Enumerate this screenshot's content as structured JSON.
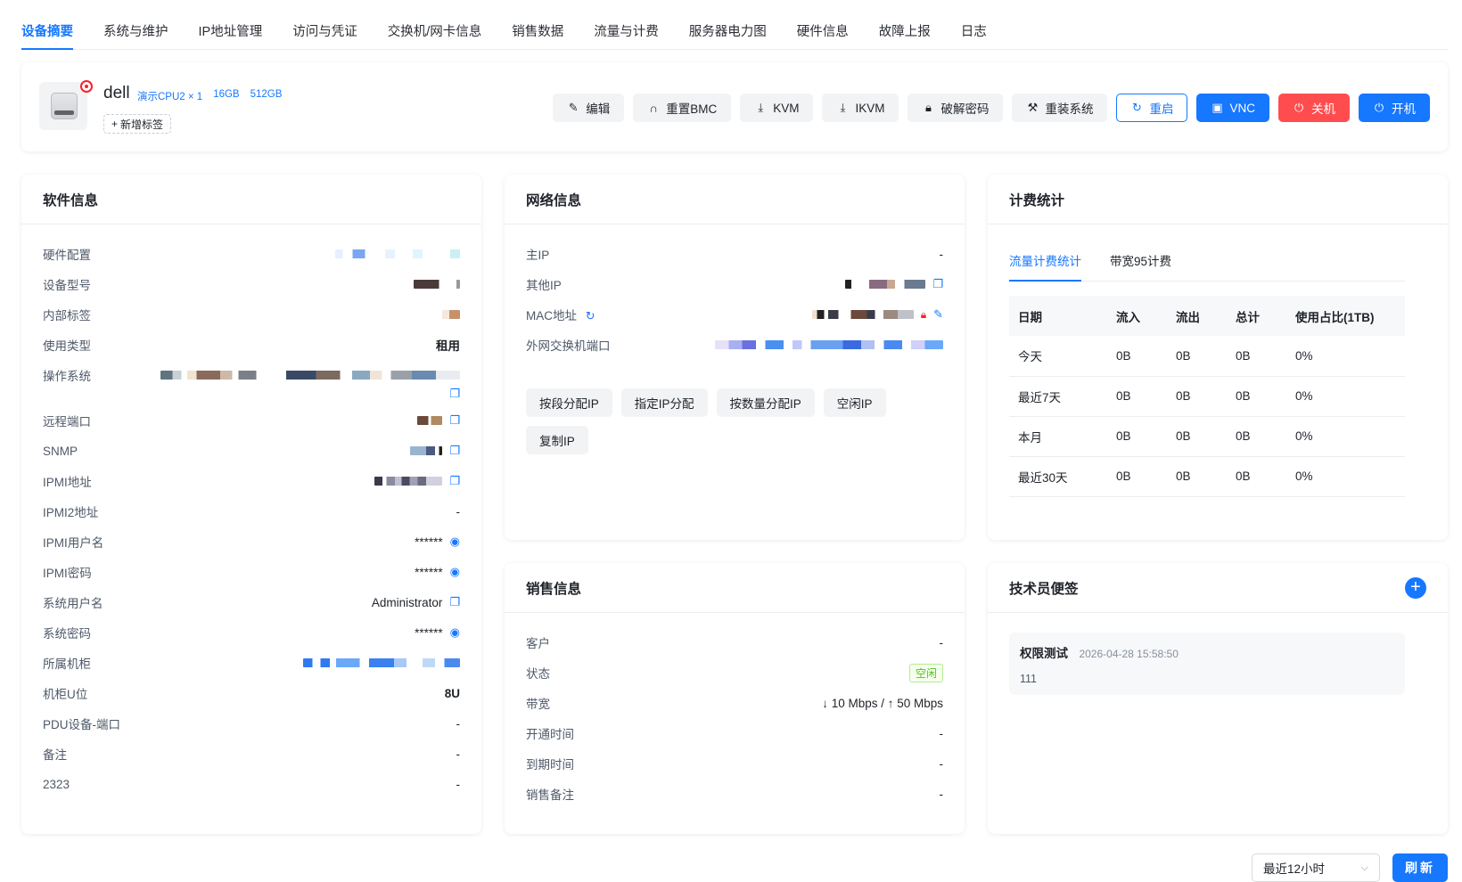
{
  "tabs": [
    "设备摘要",
    "系统与维护",
    "IP地址管理",
    "访问与凭证",
    "交换机/网卡信息",
    "销售数据",
    "流量与计费",
    "服务器电力图",
    "硬件信息",
    "故障上报",
    "日志"
  ],
  "device": {
    "name": "dell",
    "spec_cpu": "演示CPU2 × 1",
    "spec_mem": "16GB",
    "spec_disk": "512GB",
    "add_tag": "新增标签"
  },
  "actions": {
    "edit": "编辑",
    "reset_bmc": "重置BMC",
    "kvm": "KVM",
    "ikvm": "IKVM",
    "crack_pwd": "破解密码",
    "reinstall": "重装系统",
    "reboot": "重启",
    "vnc": "VNC",
    "shutdown": "关机",
    "power_on": "开机"
  },
  "software": {
    "title": "软件信息",
    "rows": [
      {
        "k": "硬件配置",
        "v": ""
      },
      {
        "k": "设备型号",
        "v": ""
      },
      {
        "k": "内部标签",
        "v": ""
      },
      {
        "k": "使用类型",
        "v": "租用"
      },
      {
        "k": "操作系统",
        "v": ""
      },
      {
        "k": "远程端口",
        "v": ""
      },
      {
        "k": "SNMP",
        "v": ""
      },
      {
        "k": "IPMI地址",
        "v": ""
      },
      {
        "k": "IPMI2地址",
        "v": "-"
      },
      {
        "k": "IPMI用户名",
        "v": "******"
      },
      {
        "k": "IPMI密码",
        "v": "******"
      },
      {
        "k": "系统用户名",
        "v": "Administrator"
      },
      {
        "k": "系统密码",
        "v": "******"
      },
      {
        "k": "所属机柜",
        "v": ""
      },
      {
        "k": "机柜U位",
        "v": "8U"
      },
      {
        "k": "PDU设备-端口",
        "v": "-"
      },
      {
        "k": "备注",
        "v": "-"
      },
      {
        "k": "2323",
        "v": "-"
      }
    ]
  },
  "network": {
    "title": "网络信息",
    "rows": [
      {
        "k": "主IP",
        "v": "-"
      },
      {
        "k": "其他IP",
        "v": ""
      },
      {
        "k": "MAC地址",
        "v": ""
      },
      {
        "k": "外网交换机端口",
        "v": ""
      }
    ],
    "buttons": [
      "按段分配IP",
      "指定IP分配",
      "按数量分配IP",
      "空闲IP",
      "复制IP"
    ]
  },
  "billing": {
    "title": "计费统计",
    "tabs": [
      "流量计费统计",
      "带宽95计费"
    ],
    "headers": [
      "日期",
      "流入",
      "流出",
      "总计",
      "使用占比(1TB)"
    ],
    "rows": [
      [
        "今天",
        "0B",
        "0B",
        "0B",
        "0%"
      ],
      [
        "最近7天",
        "0B",
        "0B",
        "0B",
        "0%"
      ],
      [
        "本月",
        "0B",
        "0B",
        "0B",
        "0%"
      ],
      [
        "最近30天",
        "0B",
        "0B",
        "0B",
        "0%"
      ]
    ]
  },
  "sales": {
    "title": "销售信息",
    "rows": [
      {
        "k": "客户",
        "v": "-"
      },
      {
        "k": "状态",
        "v": "空闲"
      },
      {
        "k": "带宽",
        "v": "↓ 10 Mbps / ↑ 50 Mbps"
      },
      {
        "k": "开通时间",
        "v": "-"
      },
      {
        "k": "到期时间",
        "v": "-"
      },
      {
        "k": "销售备注",
        "v": "-"
      }
    ]
  },
  "notes": {
    "title": "技术员便签",
    "items": [
      {
        "title": "权限测试",
        "time": "2026-04-28 15:58:50",
        "body": "111"
      }
    ]
  },
  "footer": {
    "range": "最近12小时",
    "refresh": "刷新"
  },
  "colors": {
    "primary": "#1677ff",
    "danger": "#ff4d4f",
    "success": "#52c41a"
  }
}
